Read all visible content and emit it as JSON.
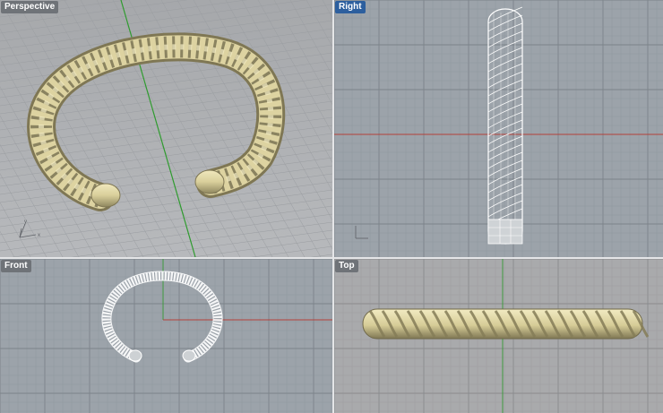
{
  "viewports": {
    "perspective": {
      "label": "Perspective",
      "active": false
    },
    "right": {
      "label": "Right",
      "active": true
    },
    "front": {
      "label": "Front",
      "active": false
    },
    "top": {
      "label": "Top",
      "active": false
    }
  },
  "axis_labels": {
    "x": "x",
    "y": "y",
    "z": "z"
  },
  "colors": {
    "viewport_bg": "#9aa1a8",
    "grid_minor": "#8b9299",
    "grid_major": "#7b828a",
    "x_axis": "#b3403a",
    "y_axis": "#3e9a3e",
    "model_fill": "#e2d9a9",
    "model_shadow": "#9d9468",
    "wireframe": "#ffffff",
    "active_tab": "#2d5f9e"
  },
  "model": {
    "name": "twisted-rope-bangle"
  }
}
